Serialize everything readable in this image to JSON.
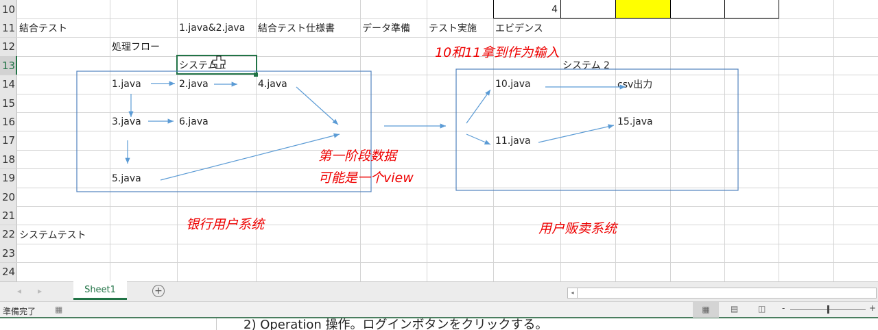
{
  "rows": [
    "10",
    "11",
    "12",
    "13",
    "14",
    "15",
    "16",
    "17",
    "18",
    "19",
    "20",
    "21",
    "22",
    "23",
    "24"
  ],
  "cells": {
    "g10": "4",
    "a11": "結合テスト",
    "c11": "1.java&2.java",
    "d11": "結合テスト仕様書",
    "e11": "データ準備",
    "f11": "テスト実施",
    "g11": "エビデンス",
    "b12": "処理フロー",
    "c13": "システム 1",
    "h13": "システム 2",
    "b14": "1.java",
    "c14": "2.java",
    "d14": "4.java",
    "g14": "10.java",
    "i14": "csv出力",
    "b16": "3.java",
    "c16": "6.java",
    "i16": "15.java",
    "g17": "11.java",
    "b19": "5.java",
    "a22": "システムテスト"
  },
  "annotations": {
    "input_note": "10和11拿到作为输入",
    "stage1_line1": "第一阶段数据",
    "stage1_line2": "可能是一个view",
    "system1": "银行用户系统",
    "system2": "用户贩卖系统"
  },
  "sheet_tab": "Sheet1",
  "status_text": "準備完了",
  "below_text": "2) Operation 操作。ログインボタンをクリックする。",
  "colors": {
    "highlight": "#ffff00",
    "accent": "#217346"
  }
}
